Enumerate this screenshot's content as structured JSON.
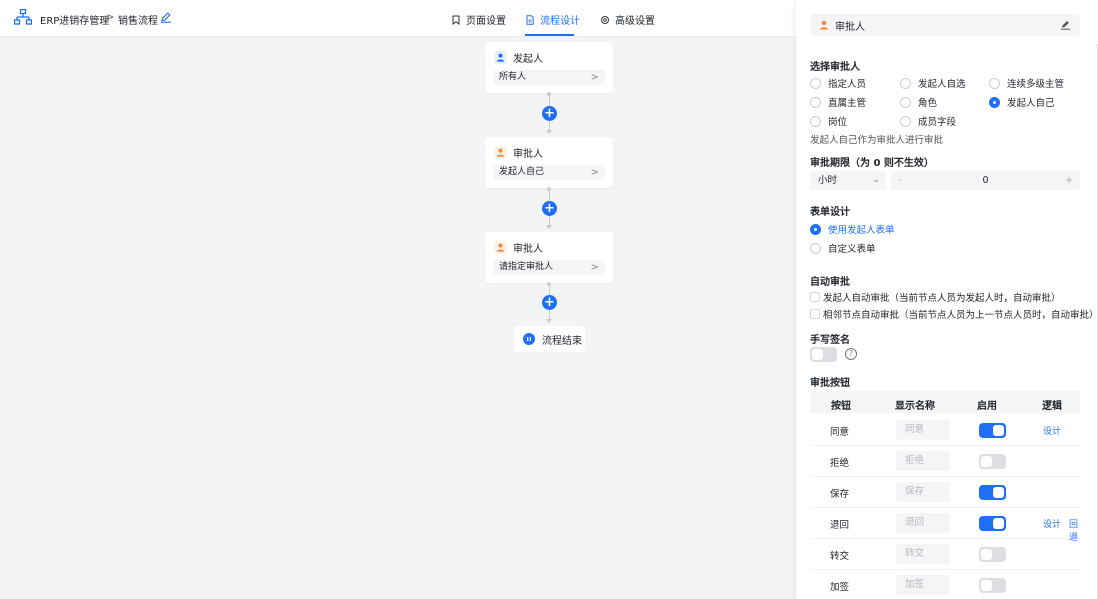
{
  "header": {
    "app_name": "ERP进销存管理",
    "separator": ">",
    "current": "销售流程",
    "tabs": [
      {
        "label": "页面设置",
        "active": false
      },
      {
        "label": "流程设计",
        "active": true
      },
      {
        "label": "高级设置",
        "active": false
      }
    ]
  },
  "flow": {
    "nodes": [
      {
        "title": "发起人",
        "value": "所有人",
        "icon": "user-icon"
      },
      {
        "title": "审批人",
        "value": "发起人自己",
        "icon": "approver-icon"
      },
      {
        "title": "审批人",
        "value": "请指定审批人",
        "icon": "approver-icon"
      }
    ],
    "end_label": "流程结束",
    "add_symbol": "+",
    "chevron": ">"
  },
  "panel": {
    "title": "审批人",
    "approver_section": "选择审批人",
    "approver_options": [
      {
        "label": "指定人员",
        "selected": false
      },
      {
        "label": "发起人自选",
        "selected": false
      },
      {
        "label": "连续多级主管",
        "selected": false
      },
      {
        "label": "直属主管",
        "selected": false
      },
      {
        "label": "角色",
        "selected": false
      },
      {
        "label": "发起人自己",
        "selected": true
      },
      {
        "label": "岗位",
        "selected": false
      },
      {
        "label": "成员字段",
        "selected": false
      }
    ],
    "approver_hint": "发起人自己作为审批人进行审批",
    "deadline_section": "审批期限（为 0 则不生效）",
    "deadline_unit": "小时",
    "deadline_value": "0",
    "stepper_minus": "-",
    "stepper_plus": "+",
    "form_section": "表单设计",
    "form_options": [
      {
        "label": "使用发起人表单",
        "selected": true
      },
      {
        "label": "自定义表单",
        "selected": false
      }
    ],
    "auto_section": "自动审批",
    "auto_options": [
      {
        "label": "发起人自动审批（当前节点人员为发起人时，自动审批）",
        "checked": false
      },
      {
        "label": "相邻节点自动审批（当前节点人员为上一节点人员时，自动审批）",
        "checked": false
      }
    ],
    "signature_section": "手写签名",
    "signature_enabled": false,
    "help_symbol": "?",
    "buttons_section": "审批按钮",
    "table_headers": [
      "按钮",
      "显示名称",
      "启用",
      "逻辑"
    ],
    "table_rows": [
      {
        "name": "同意",
        "display": "同意",
        "enabled": true,
        "links": [
          "设计"
        ]
      },
      {
        "name": "拒绝",
        "display": "拒绝",
        "enabled": false,
        "links": []
      },
      {
        "name": "保存",
        "display": "保存",
        "enabled": true,
        "links": []
      },
      {
        "name": "退回",
        "display": "退回",
        "enabled": true,
        "links": [
          "设计",
          "回退"
        ]
      },
      {
        "name": "转交",
        "display": "转交",
        "enabled": false,
        "links": []
      },
      {
        "name": "加签",
        "display": "加签",
        "enabled": false,
        "links": []
      }
    ]
  },
  "colors": {
    "accent": "#1e6ff6",
    "approver_orange": "#f08c3a",
    "background": "#f3f4f6"
  }
}
